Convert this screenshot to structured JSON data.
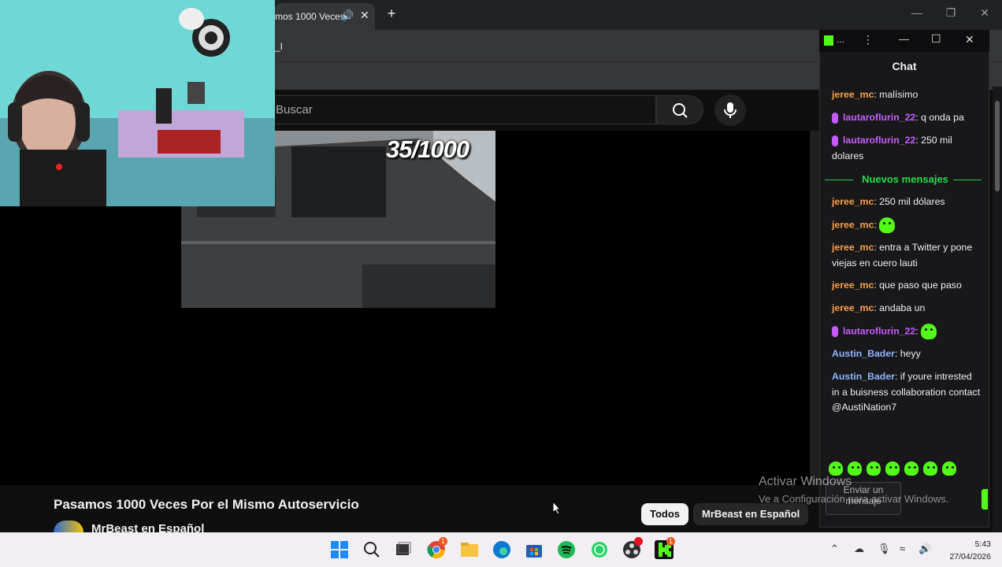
{
  "browser": {
    "tab_title": "mos 1000 Veces",
    "address_fragment": "_I",
    "new_tab_label": "+"
  },
  "youtube": {
    "search_placeholder": "Buscar",
    "video_counter": "35/1000",
    "video_title": "Pasamos 1000 Veces Por el Mismo Autoservicio",
    "channel_name": "MrBeast en Español",
    "chips": [
      "Todos",
      "MrBeast en Español"
    ]
  },
  "chat": {
    "window_icon_label": "...",
    "title": "Chat",
    "messages": [
      {
        "user": "jeree_mc",
        "text": ": malísimo"
      },
      {
        "user": "lautaroflurin_22",
        "text": ": q onda pa"
      },
      {
        "user": "lautaroflurin_22",
        "text": ": 250 mil dolares"
      },
      {
        "user": "jeree_mc",
        "text": ": 250 mil dólares"
      },
      {
        "user": "jeree_mc",
        "text": ":"
      },
      {
        "user": "jeree_mc",
        "text": ": entra a Twitter y pone viejas en cuero lauti"
      },
      {
        "user": "jeree_mc",
        "text": ": que paso que paso"
      },
      {
        "user": "jeree_mc",
        "text": ": andaba un"
      },
      {
        "user": "lautaroflurin_22",
        "text": ":"
      },
      {
        "user": "Austin_Bader",
        "text": ": heyy"
      },
      {
        "user": "Austin_Bader",
        "text": ": if youre intrested in a buisness collaboration contact @AustiNation7"
      }
    ],
    "divider_label": "Nuevos mensajes",
    "input_placeholder": "Enviar un mensaje",
    "colors": {
      "orange": "#f9a04a",
      "violet": "#c85bff",
      "blue": "#8fb4ff",
      "kick_green": "#53fc18"
    }
  },
  "watermark": {
    "line1": "Activar Windows",
    "line2": "Ve a Configuración para activar Windows."
  },
  "taskbar": {
    "time": "5:43",
    "date": "27/04/2026",
    "icons": [
      "windows-start-icon",
      "search-icon",
      "task-view-icon",
      "chrome-icon",
      "file-explorer-icon",
      "edge-icon",
      "microsoft-store-icon",
      "spotify-icon",
      "whatsapp-icon",
      "obs-icon",
      "kick-icon"
    ]
  }
}
